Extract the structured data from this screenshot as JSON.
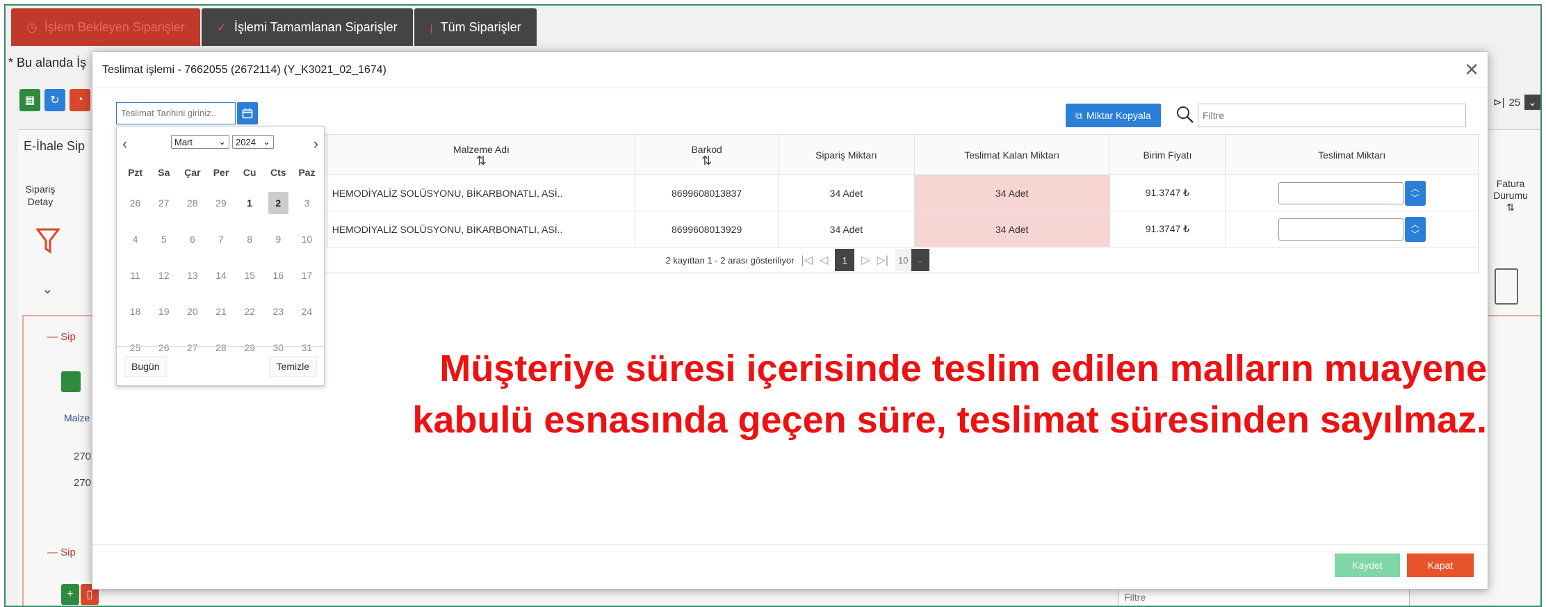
{
  "tabs": [
    {
      "label": "İşlem Bekleyen Siparişler",
      "icon": "clock-icon"
    },
    {
      "label": "İşlemi Tamamlanan Siparişler",
      "icon": "check-icon"
    },
    {
      "label": "Tüm Siparişler",
      "icon": "exclamation-icon"
    }
  ],
  "background": {
    "note": "* Bu alanda İş",
    "eihale": "E-İhale Sip",
    "siparis_detay": "Sipariş Detay",
    "alt_baslik_1": "— Sip",
    "alt_baslik_2": "— Sip",
    "malzeme_col": "Malze",
    "row1": "270",
    "row2": "270",
    "page_size": "25",
    "fatura": "Fatura Durumu",
    "filter_placeholder": "Filtre"
  },
  "modal": {
    "title": "Teslimat işlemi - 7662055 (2672114) (Y_K3021_02_1674)",
    "date_placeholder": "Teslimat Tarihini giriniz..",
    "copy_button": "Miktar Kopyala",
    "filter_placeholder": "Filtre",
    "columns": {
      "material": "Malzeme Adı",
      "barcode": "Barkod",
      "order_qty": "Sipariş Miktarı",
      "remaining_qty": "Teslimat Kalan Miktarı",
      "unit_price": "Birim Fiyatı",
      "delivery_qty": "Teslimat Miktarı"
    },
    "rows": [
      {
        "material": "HEMODİYALİZ SOLÜSYONU, BİKARBONATLI, ASİ..",
        "barcode": "8699608013837",
        "order_qty": "34 Adet",
        "remaining_qty": "34 Adet",
        "unit_price": "91.3747 ₺"
      },
      {
        "material": "HEMODİYALİZ SOLÜSYONU, BİKARBONATLI, ASİ..",
        "barcode": "8699608013929",
        "order_qty": "34 Adet",
        "remaining_qty": "34 Adet",
        "unit_price": "91.3747 ₺"
      }
    ],
    "pager": {
      "summary": "2 kayıttan 1 - 2 arası gösteriliyor",
      "current": "1",
      "size": "10"
    },
    "save_button": "Kaydet",
    "close_button": "Kapat"
  },
  "calendar": {
    "month": "Mart",
    "year": "2024",
    "weekdays": [
      "Pzt",
      "Sa",
      "Çar",
      "Per",
      "Cu",
      "Cts",
      "Paz"
    ],
    "weeks": [
      [
        "26",
        "27",
        "28",
        "29",
        "1",
        "2",
        "3"
      ],
      [
        "4",
        "5",
        "6",
        "7",
        "8",
        "9",
        "10"
      ],
      [
        "11",
        "12",
        "13",
        "14",
        "15",
        "16",
        "17"
      ],
      [
        "18",
        "19",
        "20",
        "21",
        "22",
        "23",
        "24"
      ],
      [
        "25",
        "26",
        "27",
        "28",
        "29",
        "30",
        "31"
      ]
    ],
    "today_button": "Bugün",
    "clear_button": "Temizle"
  },
  "caption": {
    "line1": "Müşteriye süresi içerisinde teslim edilen malların muayene",
    "line2": "kabulü esnasında geçen süre, teslimat süresinden sayılmaz."
  },
  "colors": {
    "accent": "#2b7fd6",
    "danger": "#e8542a",
    "save": "#7fd6a7",
    "caption": "#ee1111",
    "remaining_bg": "#f7d5d3"
  }
}
